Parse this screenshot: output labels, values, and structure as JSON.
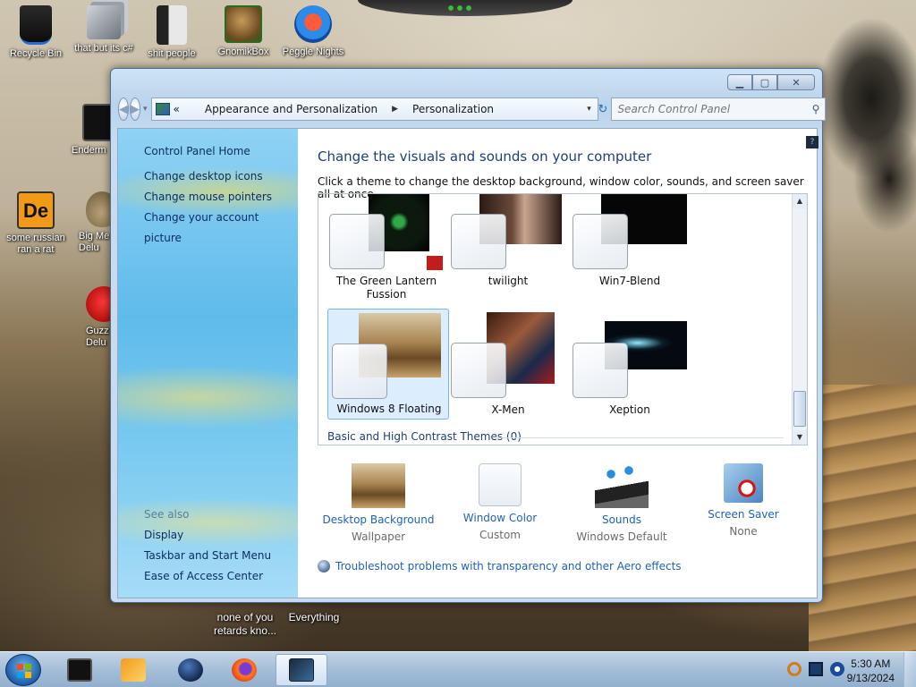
{
  "desktop": {
    "icons": [
      {
        "label": "Recycle Bin"
      },
      {
        "label": "that but its c#"
      },
      {
        "label": "shit people"
      },
      {
        "label": "GnomikBox"
      },
      {
        "label": "Peggle Nights"
      },
      {
        "label": "Enderm"
      },
      {
        "label": "some russian ran a rat"
      },
      {
        "label": "Big Me Delu"
      },
      {
        "label": "Guzz Delu"
      }
    ],
    "text_items": [
      {
        "label": "none of you retards kno..."
      },
      {
        "label": "Everything"
      }
    ]
  },
  "window": {
    "controls": {
      "minimize": "▁",
      "maximize": "▢",
      "close": "✕"
    },
    "nav": {
      "back": "◀",
      "forward": "▶",
      "recent": "▾",
      "address_overflow": "«",
      "breadcrumbs": [
        "Appearance and Personalization",
        "Personalization"
      ],
      "breadcrumb_sep": "▶",
      "address_dropdown": "▾",
      "refresh": "↻"
    },
    "search": {
      "placeholder": "Search Control Panel",
      "icon": "⚲"
    },
    "sidebar": {
      "home": "Control Panel Home",
      "links": [
        "Change desktop icons",
        "Change mouse pointers",
        "Change your account picture"
      ],
      "see_also_header": "See also",
      "see_also": [
        "Display",
        "Taskbar and Start Menu",
        "Ease of Access Center"
      ]
    },
    "main": {
      "help": "?",
      "heading": "Change the visuals and sounds on your computer",
      "description": "Click a theme to change the desktop background, window color, sounds, and screen saver all at once.",
      "themes": [
        {
          "name": "The Green Lantern Fussion",
          "selected": false
        },
        {
          "name": "twilight",
          "selected": false
        },
        {
          "name": "Win7-Blend",
          "selected": false
        },
        {
          "name": "Windows 8 Floating",
          "selected": true
        },
        {
          "name": "X-Men",
          "selected": false
        },
        {
          "name": "Xeption",
          "selected": false
        }
      ],
      "basic_section": "Basic and High Contrast Themes (0)",
      "scroll": {
        "up": "▲",
        "down": "▼"
      },
      "options": [
        {
          "title": "Desktop Background",
          "subtitle": "Wallpaper"
        },
        {
          "title": "Window Color",
          "subtitle": "Custom"
        },
        {
          "title": "Sounds",
          "subtitle": "Windows Default"
        },
        {
          "title": "Screen Saver",
          "subtitle": "None"
        }
      ],
      "troubleshoot": "Troubleshoot problems with transparency and other Aero effects"
    }
  },
  "taskbar": {
    "clock_time": "5:30 AM",
    "clock_date": "9/13/2024"
  },
  "colors": {
    "link": "#1f62b5",
    "heading": "#1e3f7a",
    "sidebar_link": "#0b2f63"
  }
}
